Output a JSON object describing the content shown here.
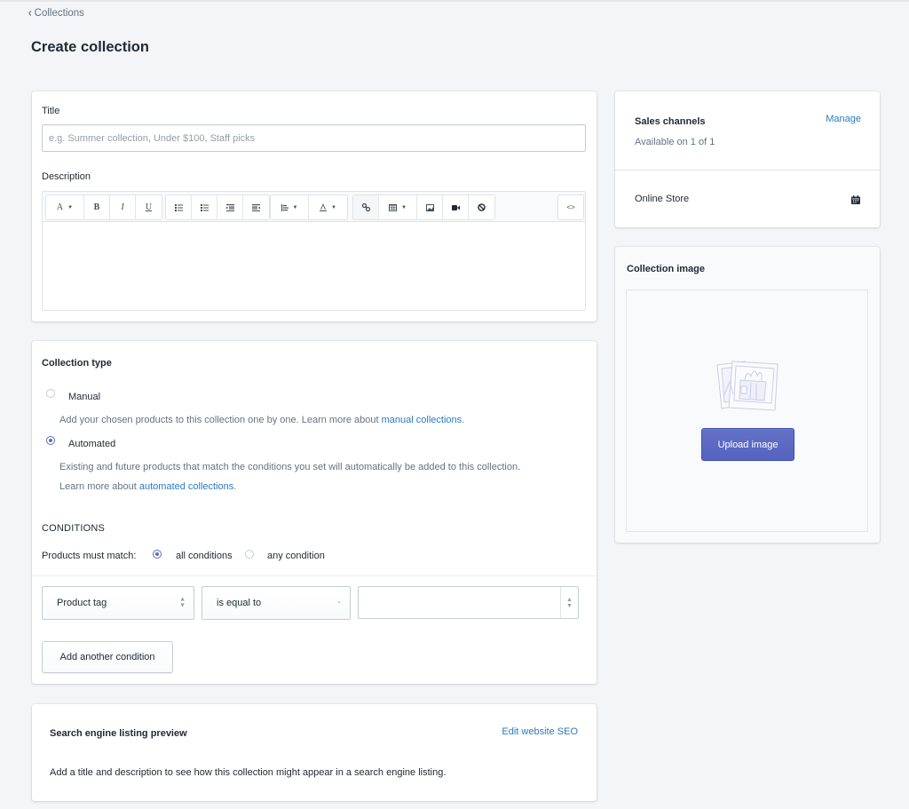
{
  "breadcrumb": {
    "label": "Collections",
    "icon": "chevron-left-icon"
  },
  "page": {
    "title": "Create collection"
  },
  "general": {
    "title_label": "Title",
    "title_value": "",
    "title_placeholder": "e.g. Summer collection, Under $100, Staff picks",
    "description_label": "Description",
    "description_value": "",
    "toolbar": {
      "font_label": "A",
      "bold_label": "B",
      "italic_label": "I",
      "underline_label": "U",
      "code_label": "<>",
      "buttons": [
        "font-style",
        "bold",
        "italic",
        "underline",
        "bulleted-list",
        "numbered-list",
        "outdent",
        "indent",
        "align",
        "text-color",
        "link",
        "table",
        "image",
        "video",
        "clear-formatting",
        "show-html"
      ]
    }
  },
  "collection_type": {
    "heading": "Collection type",
    "options": [
      {
        "label": "Manual",
        "checked": false,
        "help_text": "Add your chosen products to this collection one by one. Learn more about ",
        "link_text": "manual collections",
        "help_suffix": "."
      },
      {
        "label": "Automated",
        "checked": true,
        "help_text": "Existing and future products that match the conditions you set will automatically be added to this collection.",
        "help_text_2": "Learn more about ",
        "link_text": "automated collections",
        "help_suffix": "."
      }
    ]
  },
  "conditions": {
    "heading": "CONDITIONS",
    "match_label": "Products must match:",
    "match_options": [
      {
        "label": "all conditions",
        "checked": true
      },
      {
        "label": "any condition",
        "checked": false
      }
    ],
    "rule": {
      "field": "Product tag",
      "operator": "is equal to",
      "value": ""
    },
    "add_button": "Add another condition"
  },
  "seo": {
    "heading": "Search engine listing preview",
    "edit_link": "Edit website SEO",
    "body": "Add a title and description to see how this collection might appear in a search engine listing."
  },
  "sales_channels": {
    "heading": "Sales channels",
    "manage_link": "Manage",
    "availability": "Available on 1 of 1",
    "channels": [
      {
        "name": "Online Store",
        "icon": "calendar-icon"
      }
    ]
  },
  "collection_image": {
    "heading": "Collection image",
    "upload_button": "Upload image",
    "placeholder_icon": "photos-placeholder-icon"
  },
  "colors": {
    "primary": "#5c6ac4",
    "link": "#2a7bc0",
    "background": "#f4f5f8"
  }
}
